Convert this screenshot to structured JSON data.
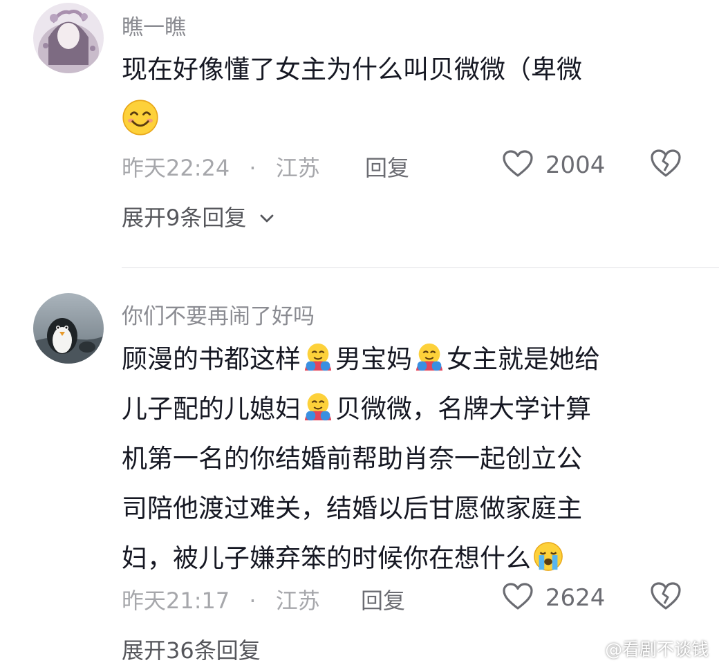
{
  "comments": [
    {
      "username": "瞧一瞧",
      "text": "现在好像懂了女主为什么叫贝微微（卑微",
      "time": "昨天22:24",
      "location": "江苏",
      "reply_label": "回复",
      "likes": "2004",
      "expand_label": "展开9条回复"
    },
    {
      "username": "你们不要再闹了好吗",
      "lines": [
        [
          "顾漫的书都这样",
          "男宝妈",
          "女主就是她给"
        ],
        [
          "儿子配的儿媳妇",
          "贝微微，名牌大学计算"
        ],
        [
          "机第一名的你结婚前帮助肖奈一起创立公"
        ],
        [
          "司陪他渡过难关，结婚以后甘愿做家庭主"
        ],
        [
          "妇，被儿子嫌弃笨的时候你在想什么"
        ]
      ],
      "time": "昨天21:17",
      "location": "江苏",
      "reply_label": "回复",
      "likes": "2624",
      "expand_label": "展开36条回复"
    }
  ],
  "meta_separator": "·",
  "watermark": "@看剧不谈钱"
}
